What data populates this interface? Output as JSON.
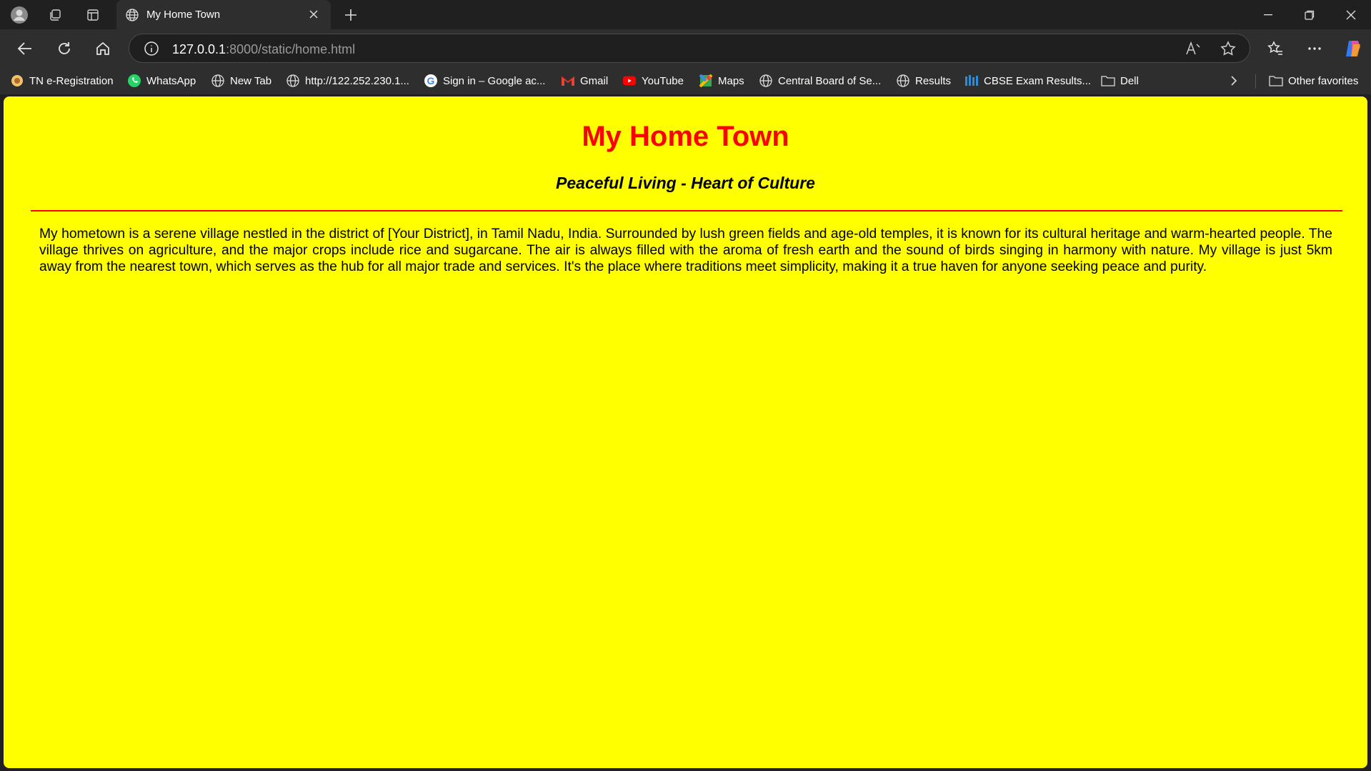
{
  "browser": {
    "tab": {
      "title": "My Home Town"
    },
    "address": {
      "host": "127.0.0.1",
      "path": ":8000/static/home.html"
    },
    "bookmarks": [
      {
        "label": "TN e-Registration",
        "icon": "tn-icon"
      },
      {
        "label": "WhatsApp",
        "icon": "whatsapp-icon"
      },
      {
        "label": "New Tab",
        "icon": "globe-icon"
      },
      {
        "label": "http://122.252.230.1...",
        "icon": "globe-icon"
      },
      {
        "label": "Sign in – Google ac...",
        "icon": "google-icon"
      },
      {
        "label": "Gmail",
        "icon": "gmail-icon"
      },
      {
        "label": "YouTube",
        "icon": "youtube-icon"
      },
      {
        "label": "Maps",
        "icon": "maps-icon"
      },
      {
        "label": "Central Board of Se...",
        "icon": "globe-icon"
      },
      {
        "label": "Results",
        "icon": "globe-icon"
      },
      {
        "label": "CBSE Exam Results...",
        "icon": "cbse-icon"
      },
      {
        "label": "Dell",
        "icon": "folder-icon"
      }
    ],
    "other_favorites": "Other favorites"
  },
  "page": {
    "heading": "My Home Town",
    "subheading": "Peaceful Living - Heart of Culture",
    "paragraph": "My hometown is a serene village nestled in the district of [Your District], in Tamil Nadu, India. Surrounded by lush green fields and age-old temples, it is known for its cultural heritage and warm-hearted people. The village thrives on agriculture, and the major crops include rice and sugarcane. The air is always filled with the aroma of fresh earth and the sound of birds singing in harmony with nature. My village is just 5km away from the nearest town, which serves as the hub for all major trade and services. It's the place where traditions meet simplicity, making it a true haven for anyone seeking peace and purity."
  },
  "colors": {
    "page_background": "#ffff00",
    "heading": "#ff0000",
    "rule": "#ff0000",
    "text": "#000000"
  }
}
